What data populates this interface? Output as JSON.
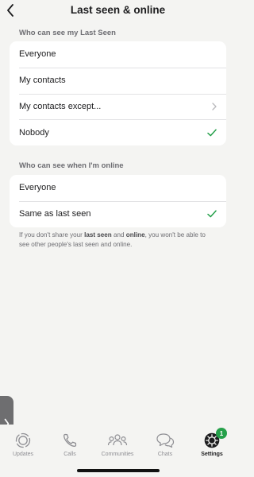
{
  "header": {
    "title": "Last seen & online",
    "back_icon": "chevron-left-icon"
  },
  "last_seen": {
    "section_label": "Who can see my Last Seen",
    "options": [
      {
        "label": "Everyone",
        "selected": false,
        "has_chevron": false
      },
      {
        "label": "My contacts",
        "selected": false,
        "has_chevron": false
      },
      {
        "label": "My contacts except...",
        "selected": false,
        "has_chevron": true
      },
      {
        "label": "Nobody",
        "selected": true,
        "has_chevron": false
      }
    ]
  },
  "online": {
    "section_label": "Who can see when I'm online",
    "options": [
      {
        "label": "Everyone",
        "selected": false
      },
      {
        "label": "Same as last seen",
        "selected": true
      }
    ]
  },
  "footnote": {
    "part1": "If you don't share your ",
    "bold1": "last seen",
    "part2": " and ",
    "bold2": "online",
    "part3": ", you won't be able to see other people's last seen and online."
  },
  "tabbar": {
    "tabs": [
      {
        "label": "Updates",
        "icon": "updates-icon",
        "active": false
      },
      {
        "label": "Calls",
        "icon": "phone-icon",
        "active": false
      },
      {
        "label": "Communities",
        "icon": "communities-icon",
        "active": false
      },
      {
        "label": "Chats",
        "icon": "chats-icon",
        "active": false
      },
      {
        "label": "Settings",
        "icon": "settings-gear-icon",
        "active": true,
        "badge": "1"
      }
    ]
  },
  "colors": {
    "accent_check": "#25a04a",
    "background": "#f4f4f2",
    "card": "#ffffff"
  }
}
